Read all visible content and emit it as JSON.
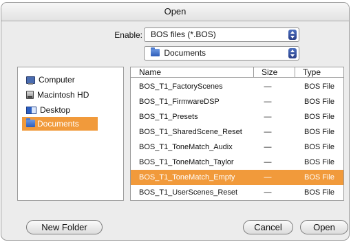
{
  "window": {
    "title": "Open"
  },
  "enable": {
    "label": "Enable:",
    "value": "BOS files (*.BOS)"
  },
  "location": {
    "value": "Documents"
  },
  "sidebar": {
    "items": [
      {
        "label": "Computer",
        "icon": "computer-icon"
      },
      {
        "label": "Macintosh HD",
        "icon": "hard-drive-icon"
      },
      {
        "label": "Desktop",
        "icon": "desktop-icon"
      },
      {
        "label": "Documents",
        "icon": "folder-icon",
        "selected": true
      }
    ]
  },
  "file_list": {
    "columns": [
      "Name",
      "Size",
      "Type"
    ],
    "rows": [
      {
        "name": "BOS_T1_FactoryScenes",
        "size": "—",
        "type": "BOS File"
      },
      {
        "name": "BOS_T1_FirmwareDSP",
        "size": "—",
        "type": "BOS File"
      },
      {
        "name": "BOS_T1_Presets",
        "size": "—",
        "type": "BOS File"
      },
      {
        "name": "BOS_T1_SharedScene_Reset",
        "size": "—",
        "type": "BOS File"
      },
      {
        "name": "BOS_T1_ToneMatch_Audix",
        "size": "—",
        "type": "BOS File"
      },
      {
        "name": "BOS_T1_ToneMatch_Taylor",
        "size": "—",
        "type": "BOS File"
      },
      {
        "name": "BOS_T1_ToneMatch_Empty",
        "size": "—",
        "type": "BOS File",
        "selected": true
      },
      {
        "name": "BOS_T1_UserScenes_Reset",
        "size": "—",
        "type": "BOS File"
      }
    ]
  },
  "buttons": {
    "new_folder": "New Folder",
    "cancel": "Cancel",
    "open": "Open"
  },
  "colors": {
    "selection": "#f19a3b",
    "popup_arrows": "#2a3f88"
  }
}
